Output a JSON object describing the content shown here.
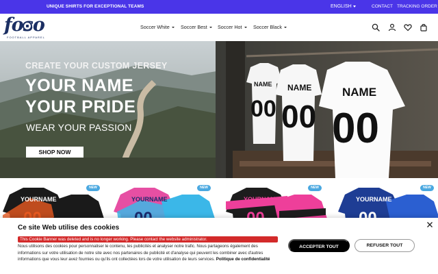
{
  "announcement": {
    "promo": "UNIQUE SHIRTS FOR EXCEPTIONAL TEAMS",
    "language": "ENGLISH",
    "contact": "CONTACT",
    "tracking": "TRACKING ORDER",
    "background_color": "#4a35e8"
  },
  "header": {
    "logo_text": "foso",
    "logo_tagline": "FOOTBALL APPAREL",
    "nav": [
      {
        "label": "Soccer White"
      },
      {
        "label": "Soccer Best"
      },
      {
        "label": "Soccer Hot"
      },
      {
        "label": "Soccer Black"
      }
    ],
    "icons": [
      "search-icon",
      "account-icon",
      "wishlist-heart-icon",
      "cart-bag-icon"
    ]
  },
  "hero": {
    "eyebrow": "CREATE YOUR CUSTOM JERSEY",
    "line1": "YOUR NAME",
    "line2": "YOUR PRIDE",
    "line3": "WEAR YOUR PASSION",
    "cta": "SHOP NOW",
    "jersey_name": "NAME",
    "jersey_number": "00"
  },
  "products": [
    {
      "badge": "NEW",
      "name_text": "YOURNAME",
      "number_text": "00",
      "primary_color": "#1a1a1a",
      "accent_color": "#e8591f"
    },
    {
      "badge": "NEW",
      "name_text": "YOURNAME",
      "number_text": "00",
      "primary_color": "#e64fa3",
      "accent_color": "#3bb7e8"
    },
    {
      "badge": "NEW",
      "name_text": "YOURNAME",
      "number_text": "00",
      "primary_color": "#1d1d1d",
      "accent_color": "#ee3f9a"
    },
    {
      "badge": "NEW",
      "name_text": "YOURNAME",
      "number_text": "00",
      "primary_color": "#1e3d94",
      "accent_color": "#2b5fd1"
    }
  ],
  "cookie": {
    "title": "Ce site Web utilise des cookies",
    "alert": "This Cookie Banner was deleted and is no longer working. Please contact the website administrator.",
    "body": "Nous utilisons des cookies pour personnaliser le contenu, les publicités et analyser notre trafic. Nous partageons également des informations sur votre utilisation de notre site avec nos partenaires de publicité et d'analyse qui peuvent les combiner avec d'autres informations que vous leur avez fournies ou qu'ils ont collectées lors de votre utilisation de leurs services.",
    "policy_link": "Politique de confidentialité",
    "accept": "ACCEPTER TOUT",
    "refuse": "REFUSER TOUT",
    "alert_color": "#d32a2a"
  }
}
